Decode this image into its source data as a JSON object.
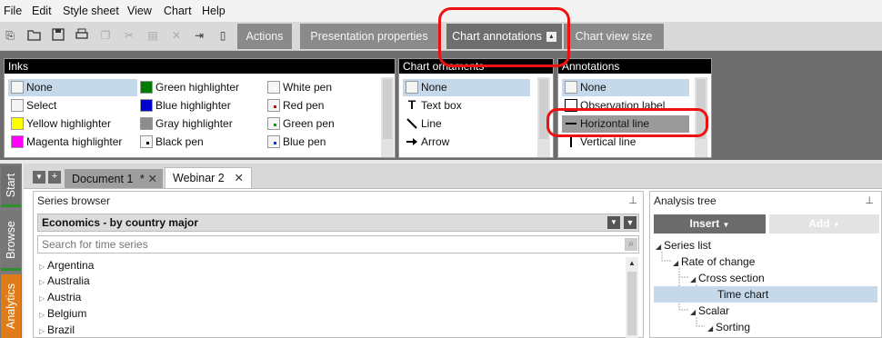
{
  "menu": [
    "File",
    "Edit",
    "Style sheet",
    "View",
    "Chart",
    "Help"
  ],
  "toolbar": {
    "icons": [
      "new-icon",
      "open-icon",
      "save-icon",
      "print-icon",
      "copy-icon",
      "cut-icon",
      "paste-icon",
      "delete-icon",
      "insert-icon",
      "document-icon"
    ],
    "tabs": [
      "Actions",
      "Presentation properties",
      "Chart annotations",
      "Chart view size"
    ],
    "active_tab": "Chart annotations"
  },
  "ribbon": {
    "inks": {
      "title": "Inks",
      "col1": [
        "None",
        "Select",
        "Yellow highlighter",
        "Magenta highlighter"
      ],
      "col2": [
        "Green highlighter",
        "Blue highlighter",
        "Gray highlighter",
        "Black pen"
      ],
      "col3": [
        "White pen",
        "Red pen",
        "Green pen",
        "Blue pen"
      ]
    },
    "ornaments": {
      "title": "Chart ornaments",
      "items": [
        "None",
        "Text box",
        "Line",
        "Arrow"
      ]
    },
    "annotations": {
      "title": "Annotations",
      "items": [
        "None",
        "Observation label",
        "Horizontal line",
        "Vertical line"
      ]
    },
    "colors": {
      "yellow": "#ffff00",
      "magenta": "#ff00ff",
      "green": "#007a00",
      "blue": "#0000cc",
      "gray": "#8c8c8c",
      "red": "#e00000",
      "pen_green": "#00a000",
      "pen_blue": "#0033ff",
      "highlight": "#e11111"
    }
  },
  "sidetabs": [
    "Start",
    "Browse",
    "Analytics"
  ],
  "documents": {
    "tabs": [
      "Document 1",
      "Webinar 2"
    ],
    "modified_marker": "*",
    "close_glyph": "✕"
  },
  "series_browser": {
    "title": "Series browser",
    "database": "Economics - by country major",
    "search_placeholder": "Search for time series",
    "countries": [
      "Argentina",
      "Australia",
      "Austria",
      "Belgium",
      "Brazil"
    ]
  },
  "analysis_tree": {
    "title": "Analysis tree",
    "insert_label": "Insert",
    "add_label": "Add",
    "nodes": [
      "Series list",
      "Rate of change",
      "Cross section",
      "Time chart",
      "Scalar",
      "Sorting"
    ]
  }
}
